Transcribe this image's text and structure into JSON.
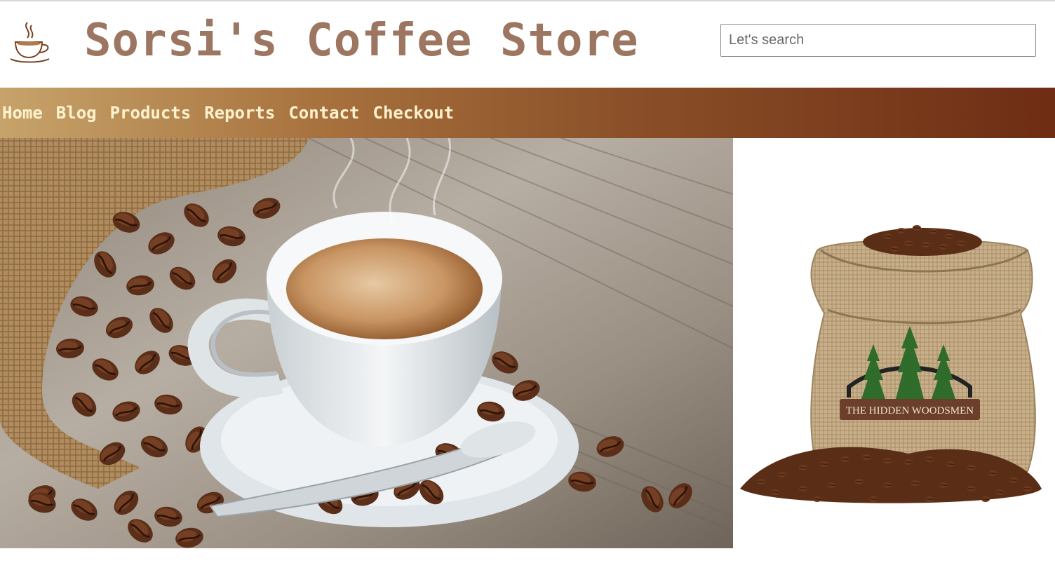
{
  "header": {
    "title": "Sorsi's Coffee Store",
    "logo_icon": "coffee-cup-icon",
    "search_placeholder": "Let's search"
  },
  "nav": {
    "items": [
      {
        "label": "Home"
      },
      {
        "label": "Blog"
      },
      {
        "label": "Products"
      },
      {
        "label": "Reports"
      },
      {
        "label": "Contact"
      },
      {
        "label": "Checkout"
      }
    ]
  },
  "images": {
    "hero_alt": "coffee cup with beans",
    "side_alt": "coffee bean sack",
    "sack_brand": "THE HIDDEN WOODSMEN"
  },
  "colors": {
    "title": "#9c7660",
    "nav_text": "#fff3cf",
    "nav_gradient_start": "#c6a36a",
    "nav_gradient_end": "#6e2d14"
  }
}
